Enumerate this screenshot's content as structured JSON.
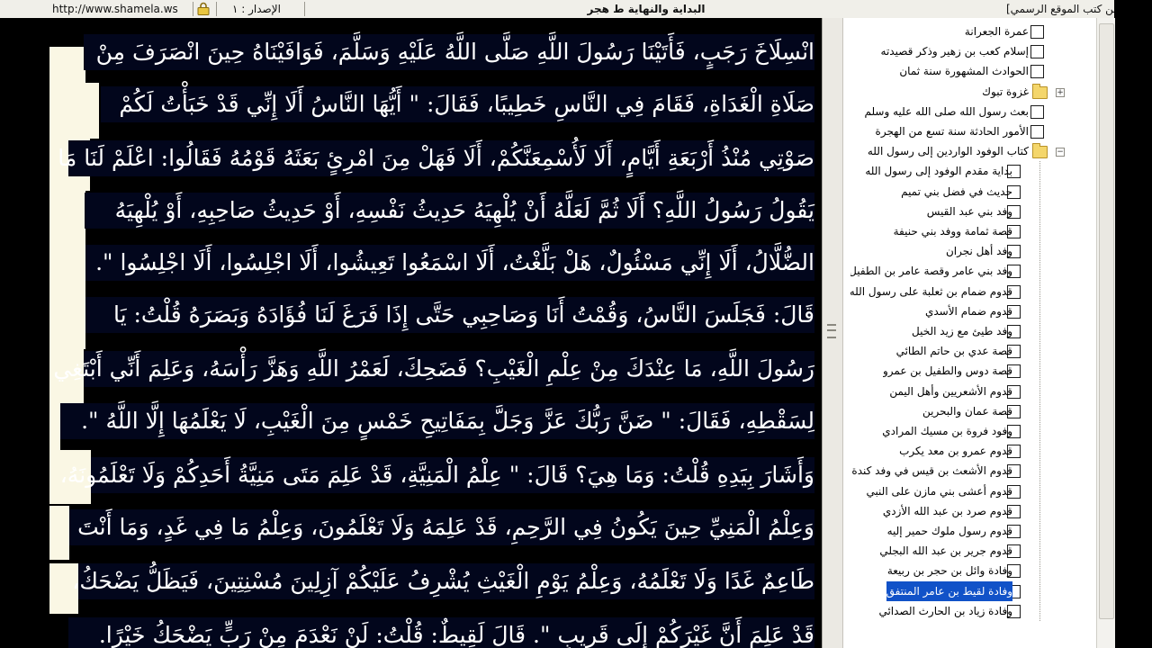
{
  "topbar": {
    "url": "http://www.shamela.ws",
    "edition": "الإصدار : ١",
    "book_title": "البداية والنهاية ط هجر",
    "official_site": "[من كتب الموقع الرسمي]"
  },
  "reader": {
    "lines": [
      "انْسِلَاخَ رَجَبٍ، فَأَتَيْنَا رَسُولَ اللَّهِ صَلَّى اللَّهُ عَلَيْهِ وَسَلَّمَ، فَوَافَيْنَاهُ حِينَ انْصَرَفَ مِنْ",
      "صَلَاةِ الْغَدَاةِ، فَقَامَ فِي النَّاسِ خَطِيبًا، فَقَالَ: \" أَيُّهَا النَّاسُ أَلَا إِنِّي قَدْ خَبَأْتُ لَكُمْ",
      "صَوْتِي مُنْذُ أَرْبَعَةِ أَيَّامٍ، أَلَا لَأُسْمِعَنَّكُمْ، أَلَا فَهَلْ مِنَ امْرِئٍ بَعَثَهُ قَوْمُهُ فَقَالُوا: اعْلَمْ لَنَا مَا",
      "يَقُولُ رَسُولُ اللَّهِ؟ أَلَا ثُمَّ لَعَلَّهُ أَنْ يُلْهِيَهُ حَدِيثُ نَفْسِهِ، أَوْ حَدِيثُ صَاحِبِهِ، أَوْ يُلْهِيَهُ",
      "الضُّلَّالُ، أَلَا إِنِّي مَسْئُولٌ، هَلْ بَلَّغْتُ، أَلَا اسْمَعُوا تَعِيشُوا، أَلَا اجْلِسُوا، أَلَا اجْلِسُوا \".",
      "قَالَ: فَجَلَسَ النَّاسُ، وَقُمْتُ أَنَا وَصَاحِبِي حَتَّى إِذَا فَرَغَ لَنَا فُؤَادَهُ وَبَصَرَهُ قُلْتُ: يَا",
      "رَسُولَ اللَّهِ، مَا عِنْدَكَ مِنْ عِلْمِ الْغَيْبِ؟ فَضَحِكَ، لَعَمْرُ اللَّهِ وَهَزَّ رَأْسَهُ، وَعَلِمَ أَنِّي أَبْتَغِي",
      "لِسَقْطِهِ، فَقَالَ: \" ضَنَّ رَبُّكَ عَزَّ وَجَلَّ بِمَفَاتِيحِ خَمْسٍ مِنَ الْغَيْبِ، لَا يَعْلَمُهَا إِلَّا اللَّهُ \".",
      "وَأَشَارَ بِيَدِهِ قُلْتُ: وَمَا هِيَ؟ قَالَ: \" عِلْمُ الْمَنِيَّةِ، قَدْ عَلِمَ مَتَى مَنِيَّةُ أَحَدِكُمْ وَلَا تَعْلَمُونَهُ،",
      "وَعِلْمُ الْمَنِيِّ حِينَ يَكُونُ فِي الرَّحِمِ، قَدْ عَلِمَهُ وَلَا تَعْلَمُونَ، وَعِلْمُ مَا فِي غَدٍ، وَمَا أَنْتَ",
      "طَاعِمٌ غَدًا وَلَا تَعْلَمُهُ، وَعِلْمُ يَوْمِ الْغَيْثِ يُشْرِفُ عَلَيْكُمْ آزِلِينَ مُسْنِتِينَ، فَيَظَلُّ يَضْحَكُ،",
      "قَدْ عَلِمَ أَنَّ غَيْرَكُمْ إِلَى قَرِيبٍ \". قَالَ لَقِيطٌ: قُلْتُ: لَنْ نَعْدَمَ مِنْ رَبٍّ يَضْحَكُ خَيْرًا."
    ]
  },
  "tree": {
    "items": [
      {
        "label": "عمرة الجعرانة",
        "type": "leaf"
      },
      {
        "label": "إسلام كعب بن زهير وذكر قصيدته",
        "type": "leaf"
      },
      {
        "label": "الحوادث المشهورة سنة ثمان",
        "type": "leaf"
      },
      {
        "label": "غزوة تبوك",
        "type": "folder-collapsed"
      },
      {
        "label": "بعث رسول الله صلى الله عليه وسلم",
        "type": "leaf"
      },
      {
        "label": "الأمور الحادثة سنة تسع من الهجرة",
        "type": "leaf"
      },
      {
        "label": "كتاب الوفود الواردين إلى رسول الله",
        "type": "folder-open"
      },
      {
        "label": "بداية مقدم الوفود إلى رسول الله",
        "type": "child"
      },
      {
        "label": "حديث في فضل بني تميم",
        "type": "child"
      },
      {
        "label": "وفد بني عبد القيس",
        "type": "child"
      },
      {
        "label": "قصة ثمامة ووفد بني حنيفة",
        "type": "child"
      },
      {
        "label": "وفد أهل نجران",
        "type": "child"
      },
      {
        "label": "وفد بني عامر وقصة عامر بن الطفيل",
        "type": "child"
      },
      {
        "label": "قدوم ضمام بن ثعلبة على رسول الله",
        "type": "child"
      },
      {
        "label": "قدوم ضمام الأسدي",
        "type": "child"
      },
      {
        "label": "وفد طيئ مع زيد الخيل",
        "type": "child"
      },
      {
        "label": "قصة عدي بن حاتم الطائي",
        "type": "child"
      },
      {
        "label": "قصة دوس والطفيل بن عمرو",
        "type": "child"
      },
      {
        "label": "قدوم الأشعريين وأهل اليمن",
        "type": "child"
      },
      {
        "label": "قصة عمان والبحرين",
        "type": "child"
      },
      {
        "label": "وفود فروة بن مسيك المرادي",
        "type": "child"
      },
      {
        "label": "قدوم عمرو بن معد يكرب",
        "type": "child"
      },
      {
        "label": "قدوم الأشعث بن قيس في وفد كندة",
        "type": "child"
      },
      {
        "label": "قدوم أعشى بني مازن على النبي",
        "type": "child"
      },
      {
        "label": "قدوم صرد بن عبد الله الأزدي",
        "type": "child"
      },
      {
        "label": "قدوم رسول ملوك حمير إليه",
        "type": "child"
      },
      {
        "label": "قدوم جرير بن عبد الله البجلي",
        "type": "child"
      },
      {
        "label": "وفادة وائل بن حجر بن ربيعة",
        "type": "child"
      },
      {
        "label": "وفادة لقيط بن عامر المنتفق",
        "type": "child-selected"
      },
      {
        "label": "وفادة زياد بن الحارث الصدائي",
        "type": "child"
      }
    ]
  }
}
